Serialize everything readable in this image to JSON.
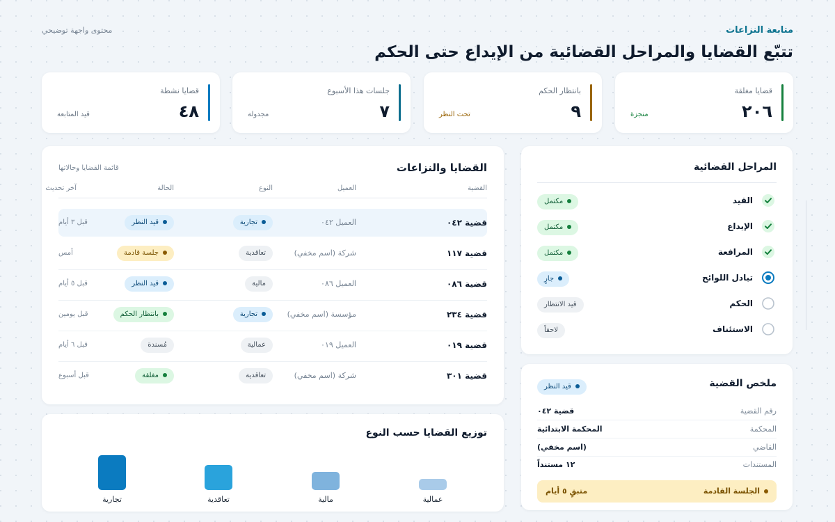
{
  "header": {
    "kicker": "متابعة النزاعات",
    "title": "تتبّع القضايا والمراحل القضائية من الإيداع حتى الحكم",
    "note": "محتوى واجهة توضيحي"
  },
  "stats": [
    {
      "label": "قضايا مغلقة",
      "value": "٢٠٦",
      "sub": "منجزة",
      "color": "#15803d"
    },
    {
      "label": "بانتظار الحكم",
      "value": "٩",
      "sub": "تحت النظر",
      "color": "#9a6508"
    },
    {
      "label": "جلسات هذا الأسبوع",
      "value": "٧",
      "sub": "مجدولة",
      "color": "#0e6f8f"
    },
    {
      "label": "قضايا نشطة",
      "value": "٤٨",
      "sub": "قيد المتابعة",
      "color": "#0b7bc0"
    }
  ],
  "cases": {
    "title": "القضايا والنزاعات",
    "subtitle": "قائمة القضايا وحالاتها",
    "columns": [
      "القضية",
      "العميل",
      "النوع",
      "الحالة",
      "آخر تحديث"
    ],
    "rows": [
      {
        "case": "قضية ٠٤٢",
        "client": "العميل ٠٤٢",
        "type": "تجارية",
        "status": "قيد النظر",
        "updated": "قبل ٣ أيام"
      },
      {
        "case": "قضية ١١٧",
        "client": "شركة (اسم مخفي)",
        "type": "تعاقدية",
        "status": "جلسة قادمة",
        "updated": "أمس"
      },
      {
        "case": "قضية ٠٨٦",
        "client": "العميل ٠٨٦",
        "type": "مالية",
        "status": "قيد النظر",
        "updated": "قبل ٥ أيام"
      },
      {
        "case": "قضية ٢٣٤",
        "client": "مؤسسة (اسم مخفي)",
        "type": "تجارية",
        "status": "بانتظار الحكم",
        "updated": "قبل يومين"
      },
      {
        "case": "قضية ٠١٩",
        "client": "العميل ٠١٩",
        "type": "عمالية",
        "status": "مُسندة",
        "updated": "قبل ٦ أيام"
      },
      {
        "case": "قضية ٣٠١",
        "client": "شركة (اسم مخفي)",
        "type": "تعاقدية",
        "status": "مغلقة",
        "updated": "قبل أسبوع"
      }
    ]
  },
  "distribution": {
    "title": "توزيع القضايا حسب النوع"
  },
  "chart_data": {
    "type": "bar",
    "title": "توزيع القضايا حسب النوع",
    "categories": [
      "عمالية",
      "مالية",
      "تعاقدية",
      "تجارية"
    ],
    "values": [
      8,
      13,
      18,
      25
    ],
    "colors": [
      "#a9cbe9",
      "#7fb3dd",
      "#2aa3dc",
      "#0b7bc0"
    ]
  },
  "stages": {
    "title": "المراحل القضائية",
    "items": [
      {
        "name": "القيد",
        "status": "مكتمل",
        "state": "done"
      },
      {
        "name": "الإيداع",
        "status": "مكتمل",
        "state": "done"
      },
      {
        "name": "المرافعة",
        "status": "مكتمل",
        "state": "done"
      },
      {
        "name": "تبادل اللوائح",
        "status": "جارٍ",
        "state": "current"
      },
      {
        "name": "الحكم",
        "status": "قيد الانتظار",
        "state": "pending"
      },
      {
        "name": "الاستئناف",
        "status": "لاحقاً",
        "state": "pending"
      }
    ]
  },
  "summary": {
    "title": "ملخص القضية",
    "status": "قيد النظر",
    "rows": [
      {
        "key": "رقم القضية",
        "value": "قضية ٠٤٢"
      },
      {
        "key": "المحكمة",
        "value": "المحكمة الابتدائية"
      },
      {
        "key": "القاضي",
        "value": "(اسم مخفي)"
      },
      {
        "key": "المستندات",
        "value": "١٢ مستنداً"
      }
    ],
    "next_label": "الجلسة القادمة",
    "next_value": "متبقٍ ٥ أيام"
  }
}
